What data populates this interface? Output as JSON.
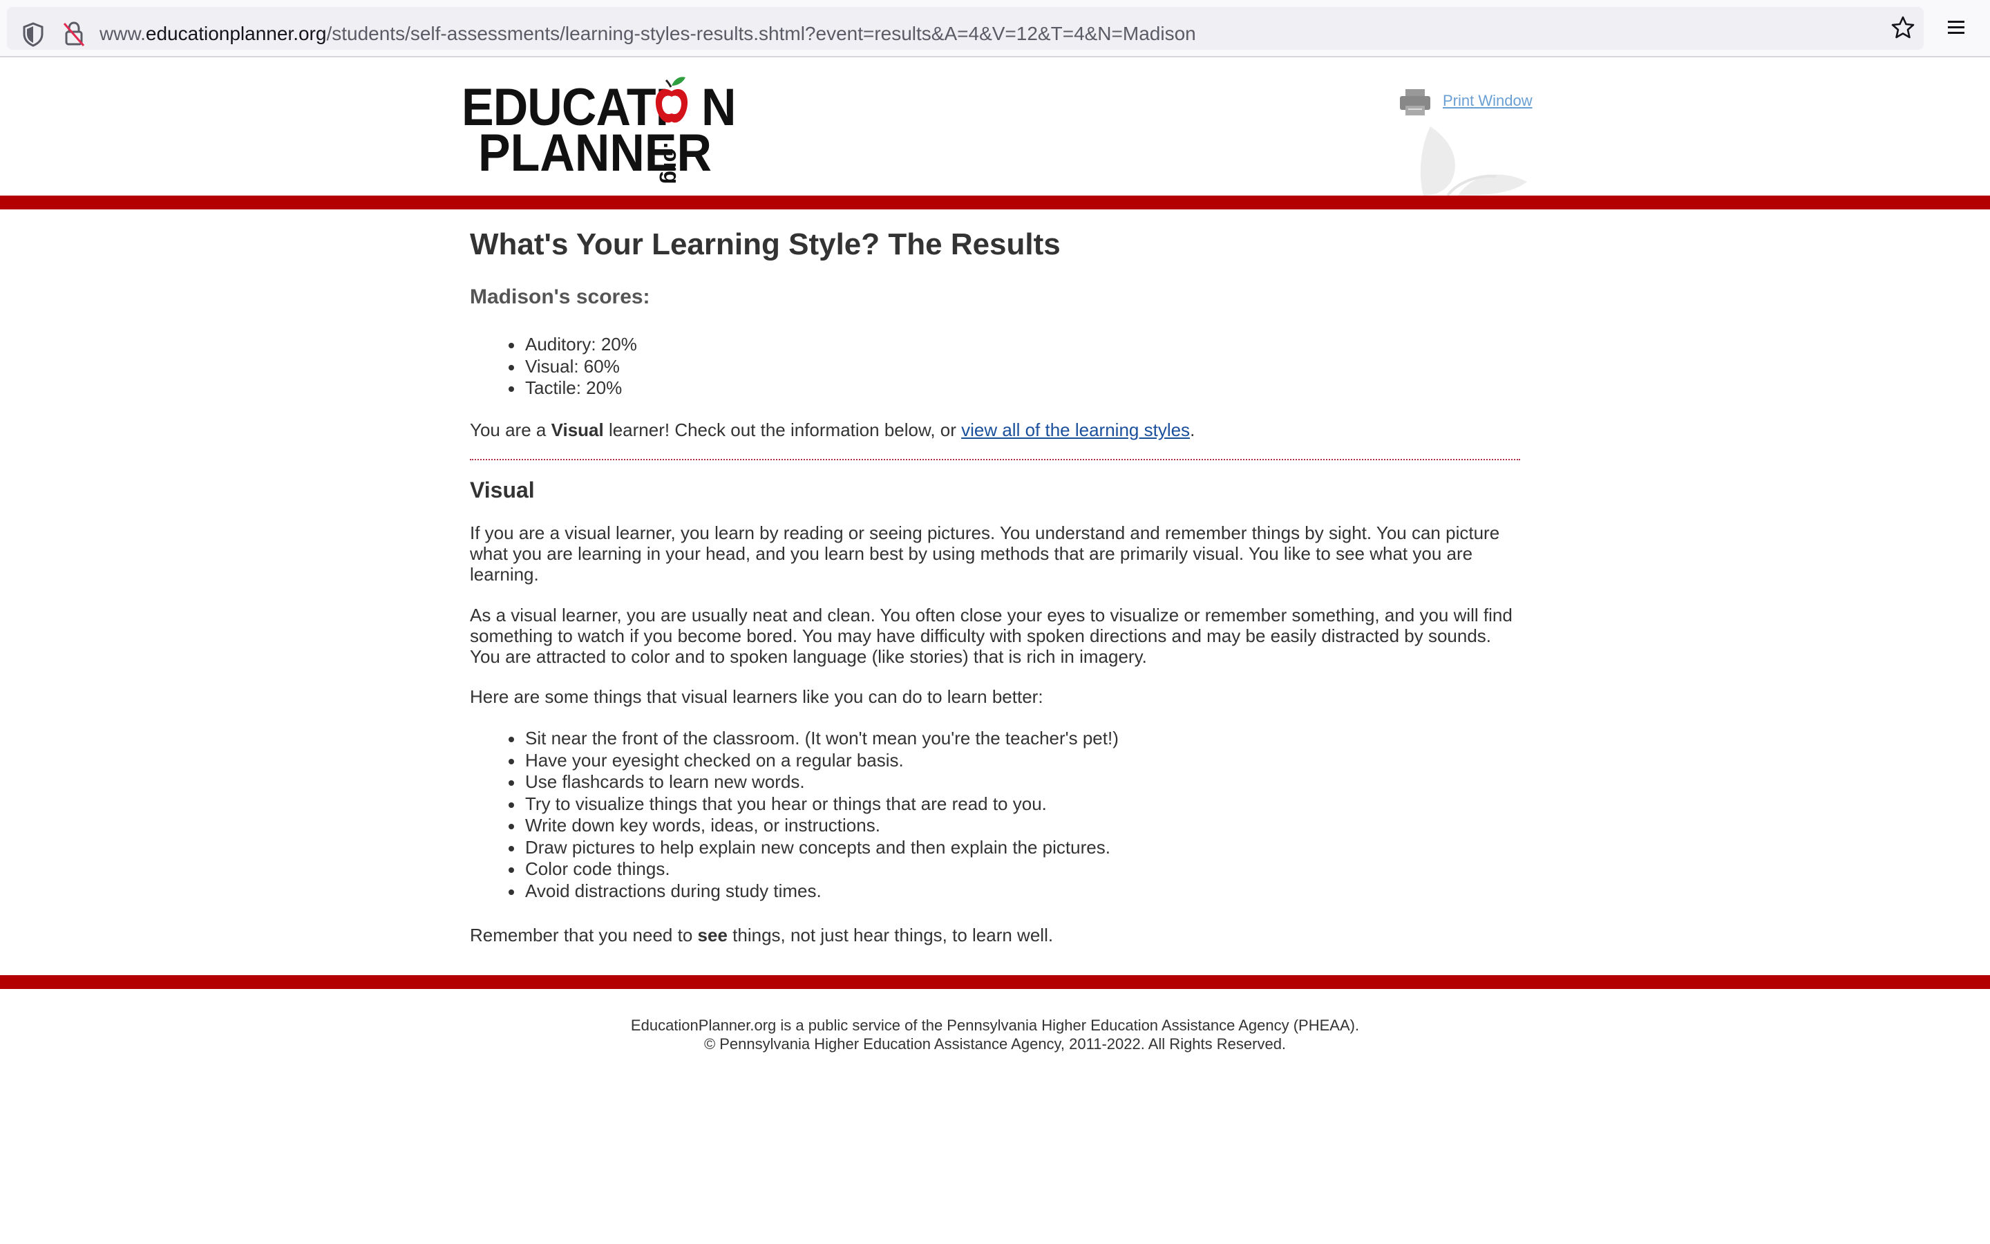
{
  "browser": {
    "url_prefix": "www.",
    "url_domain": "educationplanner.org",
    "url_path": "/students/self-assessments/learning-styles-results.shtml?event=results&A=4&V=12&T=4&N=Madison"
  },
  "header": {
    "logo_line1_a": "EDUCATI",
    "logo_line1_b": "N",
    "logo_line2": "PLANNER",
    "logo_org": ".org",
    "print_label": "Print Window"
  },
  "main": {
    "title": "What's Your Learning Style? The Results",
    "scores_heading": "Madison's scores:",
    "scores": [
      "Auditory: 20%",
      "Visual: 60%",
      "Tactile: 20%"
    ],
    "intro_before": "You are a ",
    "intro_style": "Visual",
    "intro_middle": " learner! Check out the information below, or ",
    "intro_link": "view all of the learning styles",
    "intro_end": ".",
    "style_heading": "Visual",
    "paragraph1": "If you are a visual learner, you learn by reading or seeing pictures. You understand and remember things by sight. You can picture what you are learning in your head, and you learn best by using methods that are primarily visual. You like to see what you are learning.",
    "paragraph2": "As a visual learner, you are usually neat and clean. You often close your eyes to visualize or remember something, and you will find something to watch if you become bored. You may have difficulty with spoken directions and may be easily distracted by sounds. You are attracted to color and to spoken language (like stories) that is rich in imagery.",
    "tips_intro": "Here are some things that visual learners like you can do to learn better:",
    "tips": [
      "Sit near the front of the classroom. (It won't mean you're the teacher's pet!)",
      "Have your eyesight checked on a regular basis.",
      "Use flashcards to learn new words.",
      "Try to visualize things that you hear or things that are read to you.",
      "Write down key words, ideas, or instructions.",
      "Draw pictures to help explain new concepts and then explain the pictures.",
      "Color code things.",
      "Avoid distractions during study times."
    ],
    "closing_before": "Remember that you need to ",
    "closing_bold": "see",
    "closing_after": " things, not just hear things, to learn well."
  },
  "footer": {
    "line1": "EducationPlanner.org is a public service of the Pennsylvania Higher Education Assistance Agency (PHEAA).",
    "line2": "© Pennsylvania Higher Education Assistance Agency, 2011-2022. All Rights Reserved."
  },
  "colors": {
    "brand_red": "#b30000",
    "link_blue": "#1a4f9c",
    "print_link": "#6a9fd4"
  },
  "icons": [
    "shield-icon",
    "lock-slash-icon",
    "star-icon",
    "menu-icon",
    "apple-icon",
    "printer-icon",
    "leaf-icon"
  ]
}
